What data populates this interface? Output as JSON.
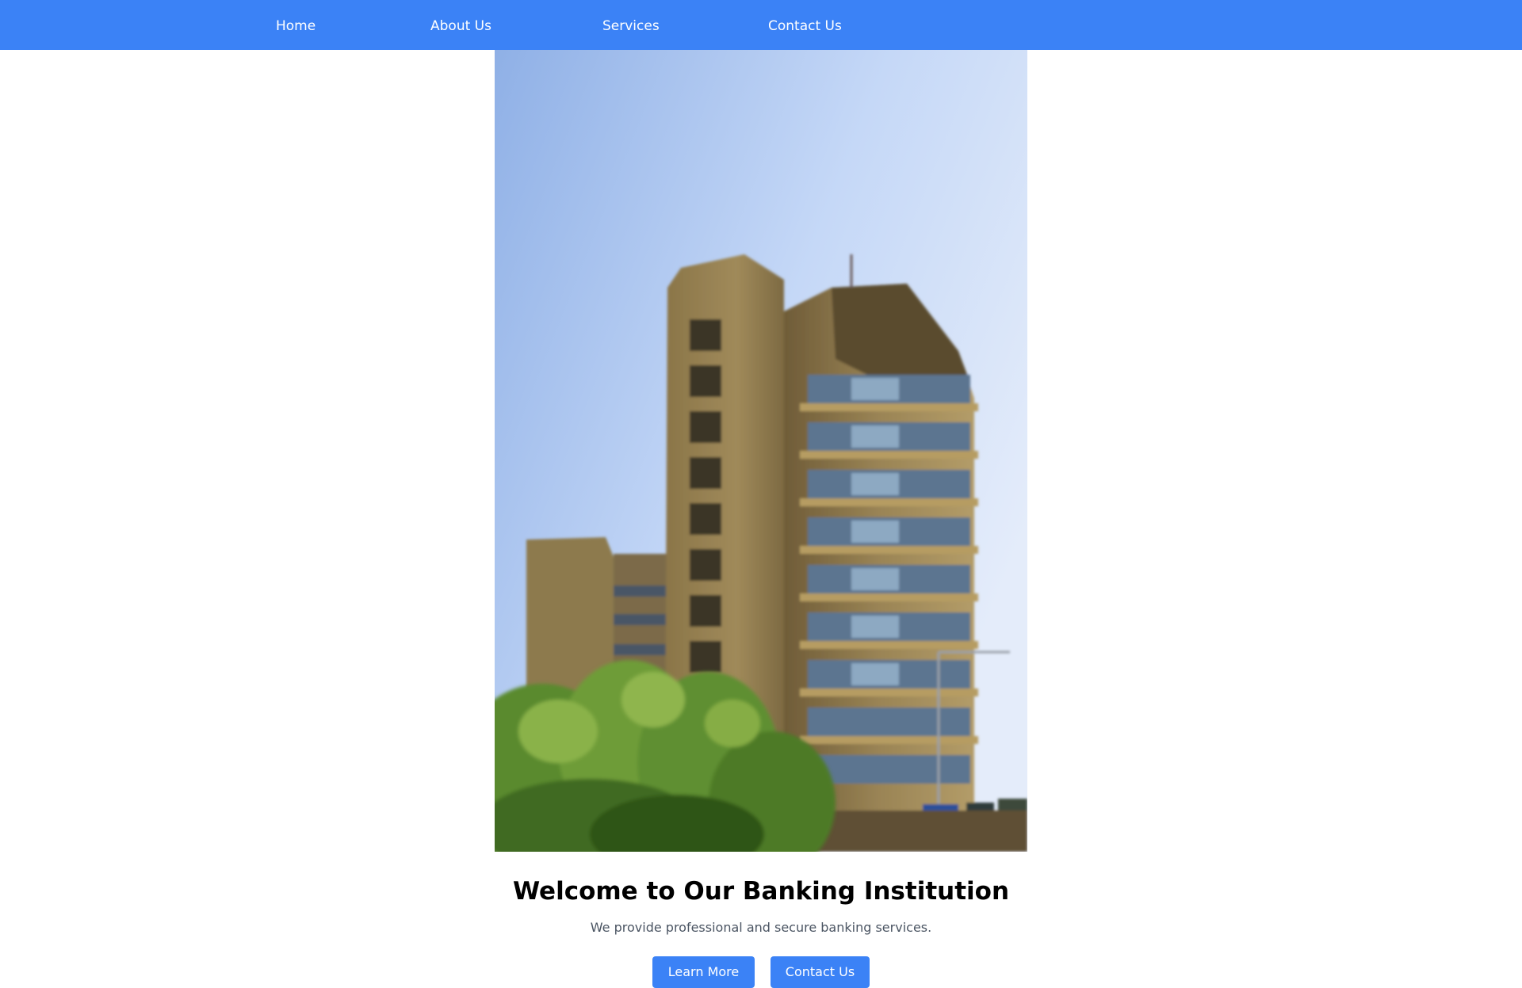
{
  "nav": {
    "items": [
      {
        "label": "Home"
      },
      {
        "label": "About Us"
      },
      {
        "label": "Services"
      },
      {
        "label": "Contact Us"
      }
    ]
  },
  "hero": {
    "image_icon": "office-building-photo",
    "title": "Welcome to Our Banking Institution",
    "subtitle": "We provide professional and secure banking services.",
    "buttons": {
      "learn_more": "Learn More",
      "contact_us": "Contact Us"
    }
  },
  "colors": {
    "accent": "#3b82f6",
    "background": "#ffffff",
    "title": "#000000",
    "subtitle": "#4b5563"
  }
}
